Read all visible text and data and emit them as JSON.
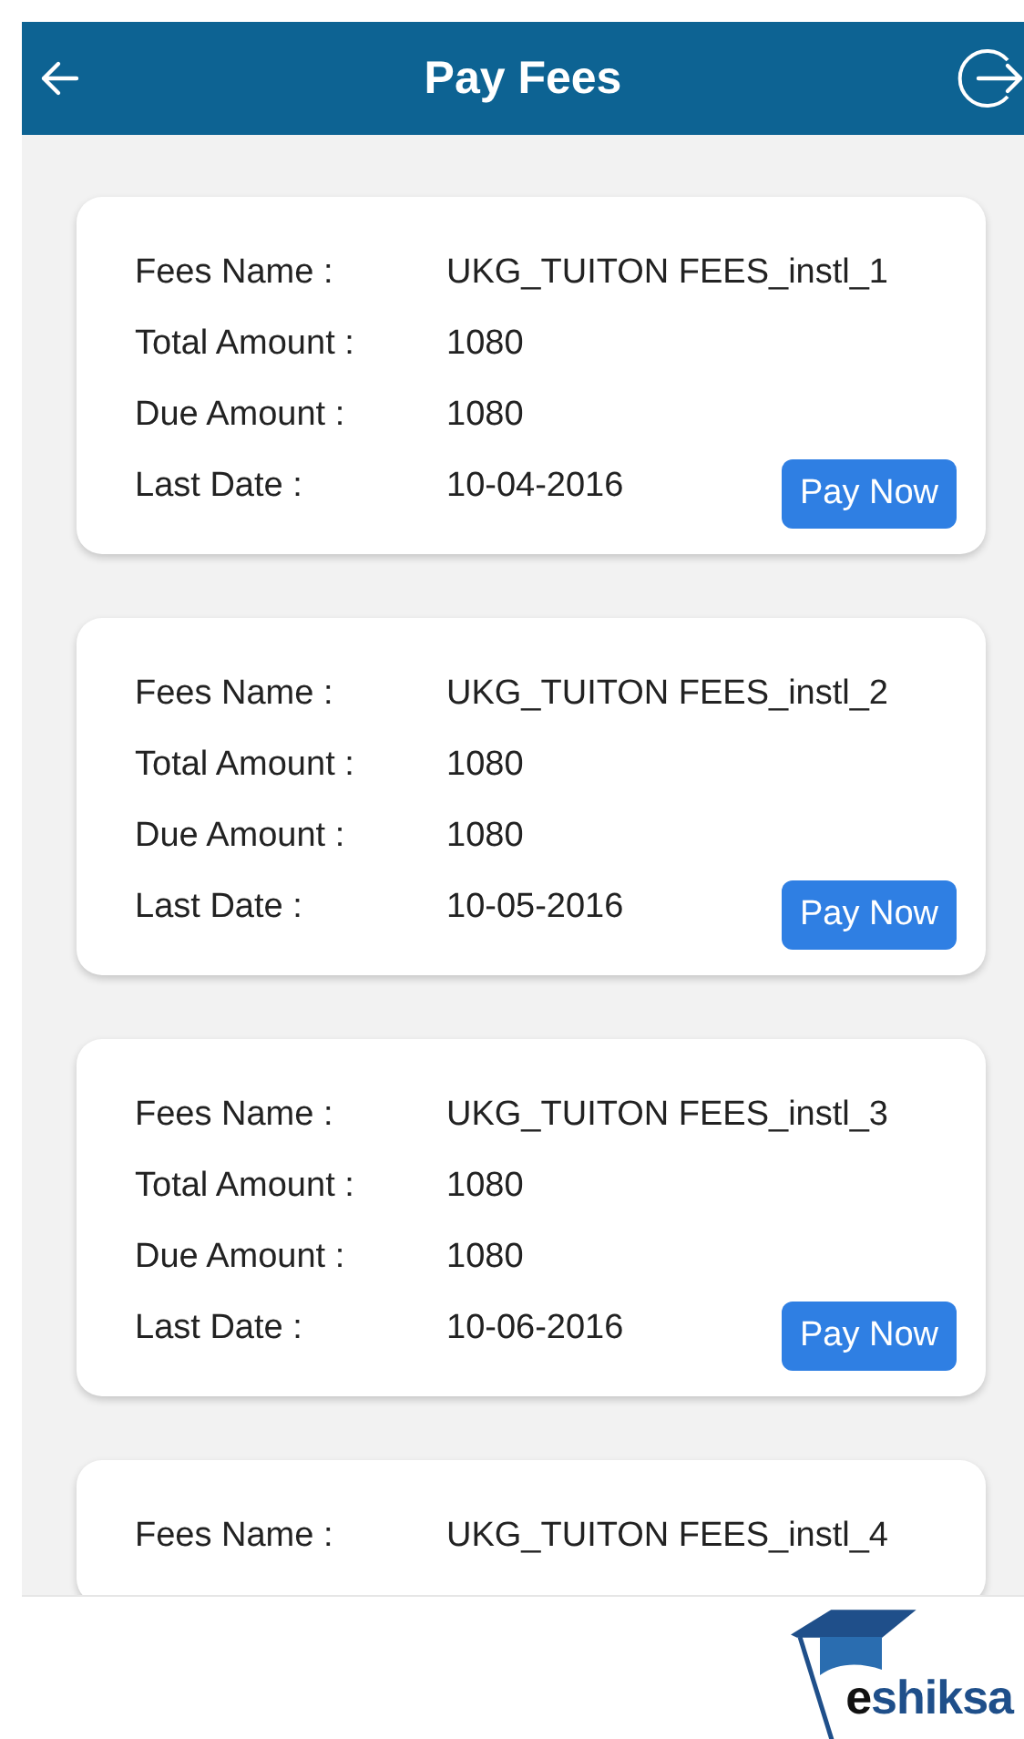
{
  "header": {
    "title": "Pay Fees"
  },
  "fees": [
    {
      "rows": [
        {
          "label": "Fees Name :",
          "value": "UKG_TUITON FEES_instl_1"
        },
        {
          "label": "Total Amount :",
          "value": "1080"
        },
        {
          "label": "Due Amount :",
          "value": "1080"
        },
        {
          "label": "Last Date :",
          "value": "10-04-2016"
        }
      ],
      "button": "Pay Now"
    },
    {
      "rows": [
        {
          "label": "Fees Name :",
          "value": "UKG_TUITON FEES_instl_2"
        },
        {
          "label": "Total Amount :",
          "value": "1080"
        },
        {
          "label": "Due Amount :",
          "value": "1080"
        },
        {
          "label": "Last Date :",
          "value": "10-05-2016"
        }
      ],
      "button": "Pay Now"
    },
    {
      "rows": [
        {
          "label": "Fees Name :",
          "value": "UKG_TUITON FEES_instl_3"
        },
        {
          "label": "Total Amount :",
          "value": "1080"
        },
        {
          "label": "Due Amount :",
          "value": "1080"
        },
        {
          "label": "Last Date :",
          "value": "10-06-2016"
        }
      ],
      "button": "Pay Now"
    },
    {
      "rows": [
        {
          "label": "Fees Name :",
          "value": "UKG_TUITON FEES_instl_4"
        }
      ]
    }
  ],
  "logo": {
    "text_1": "e",
    "text_2": "shiksa"
  }
}
